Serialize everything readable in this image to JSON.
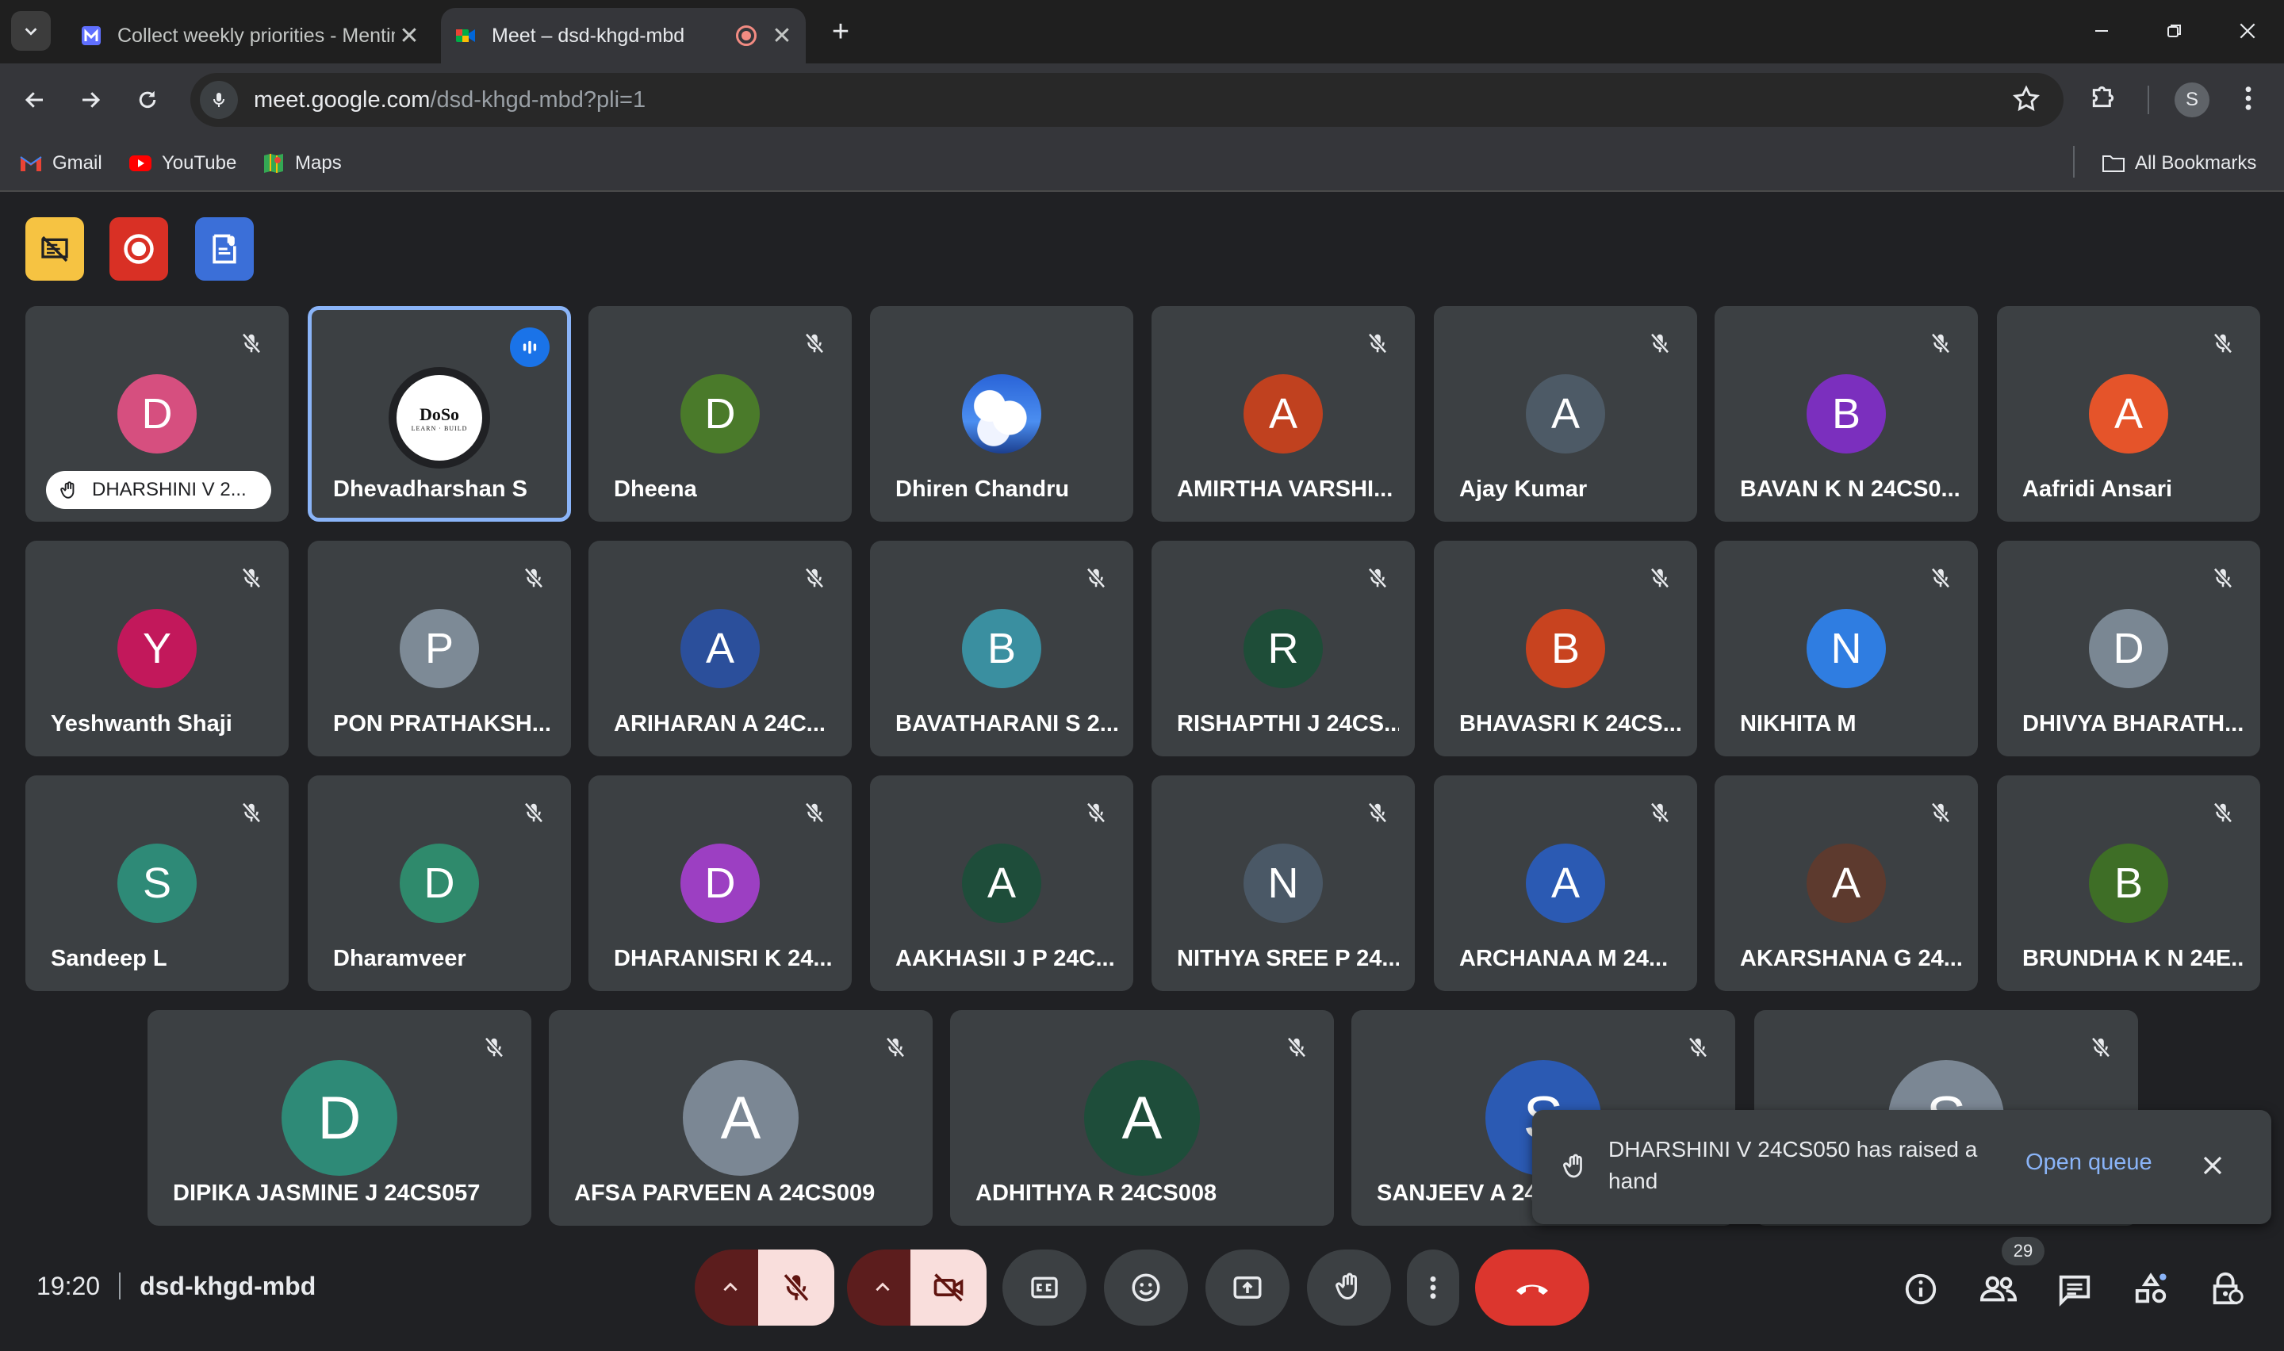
{
  "browser": {
    "tabs": [
      {
        "title": "Collect weekly priorities - Mentimeter",
        "close": "✕"
      },
      {
        "title": "Meet – dsd-khgd-mbd",
        "close": "✕"
      }
    ],
    "new_tab": "+",
    "url_host": "meet.google.com",
    "url_path": "/dsd-khgd-mbd?pli=1",
    "profile_initial": "S",
    "bookmarks": [
      "Gmail",
      "YouTube",
      "Maps"
    ],
    "all_bookmarks": "All Bookmarks"
  },
  "meet": {
    "participants": [
      {
        "name": "DHARSHINI V 2...",
        "initial": "D",
        "color": "#d64f7f",
        "hand_raised": true
      },
      {
        "name": "Dhevadharshan S",
        "logo_text": "DoSo",
        "logo_sub": "LEARN · BUILD",
        "speaking": true
      },
      {
        "name": "Dheena",
        "initial": "D",
        "color": "#4a7a2a"
      },
      {
        "name": "Dhiren Chandru",
        "image": "sky-clouds"
      },
      {
        "name": "AMIRTHA VARSHI...",
        "initial": "A",
        "color": "#c0411f"
      },
      {
        "name": "Ajay Kumar",
        "initial": "A",
        "color": "#4d5a66"
      },
      {
        "name": "BAVAN K N 24CS0...",
        "initial": "B",
        "color": "#7b2fbe"
      },
      {
        "name": "Aafridi Ansari",
        "initial": "A",
        "color": "#e5542a"
      },
      {
        "name": "Yeshwanth Shaji",
        "initial": "Y",
        "color": "#c2185b"
      },
      {
        "name": "PON PRATHAKSH...",
        "initial": "P",
        "color": "#7d8a96"
      },
      {
        "name": "ARIHARAN A 24C...",
        "initial": "A",
        "color": "#2b4f9b"
      },
      {
        "name": "BAVATHARANI S 2...",
        "initial": "B",
        "color": "#3a8fa0"
      },
      {
        "name": "RISHAPTHI J 24CS...",
        "initial": "R",
        "color": "#1e4d38"
      },
      {
        "name": "BHAVASRI K 24CS...",
        "initial": "B",
        "color": "#c8431f"
      },
      {
        "name": "NIKHITA M",
        "initial": "N",
        "color": "#2f7de1"
      },
      {
        "name": "DHIVYA BHARATH...",
        "initial": "D",
        "color": "#7a8793"
      },
      {
        "name": "Sandeep L",
        "initial": "S",
        "color": "#2e8a77"
      },
      {
        "name": "Dharamveer",
        "initial": "D",
        "color": "#2f8a6c"
      },
      {
        "name": "DHARANISRI K 24...",
        "initial": "D",
        "color": "#9c3fc2"
      },
      {
        "name": "AAKHASII J P 24C...",
        "initial": "A",
        "color": "#1e4d3a"
      },
      {
        "name": "NITHYA SREE P 24...",
        "initial": "N",
        "color": "#4a5866"
      },
      {
        "name": "ARCHANAA M 24...",
        "initial": "A",
        "color": "#2b5ab3"
      },
      {
        "name": "AKARSHANA G 24...",
        "initial": "A",
        "color": "#5d3a2e"
      },
      {
        "name": "BRUNDHA K N 24E...",
        "initial": "B",
        "color": "#3e6e26"
      },
      {
        "name": "DIPIKA JASMINE J 24CS057",
        "initial": "D",
        "color": "#2e8a77"
      },
      {
        "name": "AFSA PARVEEN A 24CS009",
        "initial": "A",
        "color": "#7b8794"
      },
      {
        "name": "ADHITHYA R 24CS008",
        "initial": "A",
        "color": "#1e4d3a"
      },
      {
        "name": "SANJEEV A 24...",
        "initial": "S",
        "color": "#2b5ab3"
      },
      {
        "name": "",
        "initial": "S",
        "color": "#7b8794"
      }
    ],
    "toast": {
      "message": "DHARSHINI V 24CS050 has raised a hand",
      "action": "Open queue"
    },
    "time": "19:20",
    "meeting_code": "dsd-khgd-mbd",
    "participant_count": "29"
  }
}
